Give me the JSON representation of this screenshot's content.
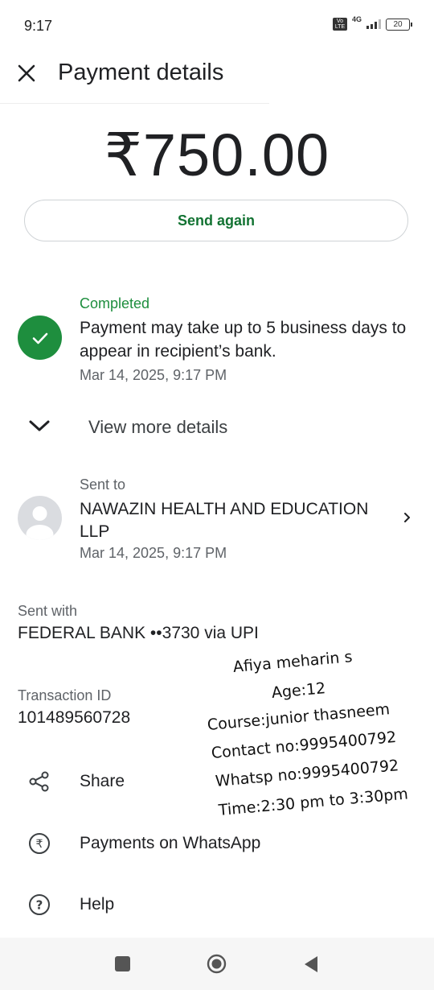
{
  "status_bar": {
    "time": "9:17",
    "volte": "Vo LTE",
    "network": "4G",
    "battery": "20"
  },
  "header": {
    "title": "Payment details",
    "close_icon": "close-icon"
  },
  "payment": {
    "amount": "₹750.00",
    "send_again_label": "Send again"
  },
  "status": {
    "label": "Completed",
    "message": "Payment may take up to 5 business days to appear in recipient’s bank.",
    "datetime": "Mar 14, 2025, 9:17 PM",
    "icon": "check-circle-icon",
    "color": "#1e8e3e"
  },
  "details_toggle": {
    "label": "View more details",
    "icon": "chevron-down-icon"
  },
  "recipient": {
    "section_label": "Sent to",
    "name": "NAWAZIN HEALTH AND EDUCATION LLP",
    "datetime": "Mar 14, 2025, 9:17 PM",
    "icon": "avatar-icon"
  },
  "payment_method": {
    "label": "Sent with",
    "value": "FEDERAL BANK ••3730 via UPI"
  },
  "transaction": {
    "label": "Transaction ID",
    "id": "101489560728"
  },
  "actions": [
    {
      "label": "Share",
      "icon": "share-icon"
    },
    {
      "label": "Payments on WhatsApp",
      "icon": "rupee-circle-icon"
    },
    {
      "label": "Help",
      "icon": "help-icon"
    }
  ],
  "handwritten_note": [
    "Afiya meharin s",
    "Age:12",
    "Course:junior thasneem",
    "Contact no:9995400792",
    "Whatsp no:9995400792",
    "Time:2:30 pm to 3:30pm"
  ],
  "nav_bar": {
    "recents_icon": "square-icon",
    "home_icon": "home-circle-icon",
    "back_icon": "back-triangle-icon"
  },
  "colors": {
    "accent_green": "#1e8e3e",
    "button_text_green": "#137333",
    "text_primary": "#202124",
    "text_secondary": "#5f6368"
  }
}
